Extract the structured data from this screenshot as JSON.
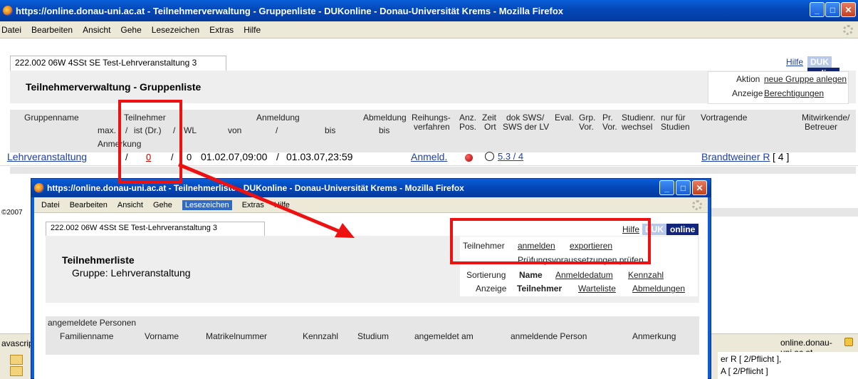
{
  "outer": {
    "title": "https://online.donau-uni.ac.at - Teilnehmerverwaltung - Gruppenliste - DUKonline - Donau-Universität Krems - Mozilla Firefox",
    "menu": [
      "Datei",
      "Bearbeiten",
      "Ansicht",
      "Gehe",
      "Lesezeichen",
      "Extras",
      "Hilfe"
    ],
    "course_tab": "222.002 06W 4SSt SE Test-Lehrveranstaltung 3",
    "help": "Hilfe",
    "duk": "DUK",
    "online": "online",
    "page_title": "Teilnehmerverwaltung - Gruppenliste",
    "aktion_label": "Aktion",
    "aktion_link": "neue Gruppe anlegen",
    "anzeige_label": "Anzeige",
    "anzeige_link": "Berechtigungen",
    "headers": {
      "gruppenname": "Gruppenname",
      "teilnehmer": "Teilnehmer",
      "anmeldung": "Anmeldung",
      "abmeldung": "Abmeldung",
      "reihungs": "Reihungs-",
      "anz": "Anz.",
      "zeit": "Zeit",
      "dok_sws": "dok SWS/",
      "eval": "Eval.",
      "grp": "Grp.",
      "pr": "Pr.",
      "studienr": "Studienr.",
      "nur_fuer": "nur für",
      "vortragende": "Vortragende",
      "mitwirkende": "Mitwirkende/",
      "max": "max.",
      "slash1": "/",
      "ist": "ist (Dr.)",
      "slash2": "/",
      "wl": "WL",
      "von": "von",
      "slash3": "/",
      "bis1": "bis",
      "bis2": "bis",
      "verfahren": "verfahren",
      "pos": "Pos.",
      "ort": "Ort",
      "sws_lv": "SWS der LV",
      "vor1": "Vor.",
      "vor2": "Vor.",
      "wechsel": "wechsel",
      "studien": "Studien",
      "betreuer": "Betreuer",
      "anmerkung": "Anmerkung"
    },
    "row": {
      "gruppenname": "Lehrveranstaltung",
      "slash_a": "/",
      "ist_value": "0",
      "slash_b": "/",
      "wl_value": "0",
      "von": "01.02.07,09:00",
      "slash_c": "/",
      "bis": "01.03.07,23:59",
      "anmeld": "Anmeld.",
      "sws": "5.3 / 4",
      "vortragende": "Brandtweiner R",
      "vortragende_count": "[ 4 ]"
    },
    "copyright": "©2007",
    "status_left": "avascrip",
    "status_right": "online.donau-uni.ac.at",
    "bg_line1": "er R [ 2/Pflicht ],",
    "bg_line2": "A [ 2/Pflicht ]"
  },
  "popup": {
    "title": "https://online.donau-uni.ac.at - Teilnehmerliste - DUKonline - Donau-Universität Krems - Mozilla Firefox",
    "menu": [
      "Datei",
      "Bearbeiten",
      "Ansicht",
      "Gehe",
      "Lesezeichen",
      "Extras",
      "Hilfe"
    ],
    "course_tab": "222.002 06W 4SSt SE Test-Lehrveranstaltung 3",
    "help": "Hilfe",
    "duk": "DUK",
    "online": "online",
    "page_title": "Teilnehmerliste",
    "gruppe": "Gruppe: Lehrveranstaltung",
    "teilnehmer_label": "Teilnehmer",
    "anmelden": "anmelden",
    "exportieren": "exportieren",
    "pruefung": "Prüfungsvoraussetzungen prüfen",
    "sortierung_label": "Sortierung",
    "sort_name": "Name",
    "sort_anmeldedatum": "Anmeldedatum",
    "sort_kennzahl": "Kennzahl",
    "anzeige_label": "Anzeige",
    "anz_teilnehmer": "Teilnehmer",
    "anz_warteliste": "Warteliste",
    "anz_abmeldungen": "Abmeldungen",
    "section": "angemeldete Personen",
    "cols": [
      "Familienname",
      "Vorname",
      "Matrikelnummer",
      "Kennzahl",
      "Studium",
      "angemeldet am",
      "anmeldende Person",
      "Anmerkung"
    ]
  },
  "colors": {
    "title_bar": "#0a5fd8",
    "annotation": "#ee1111",
    "link": "#1f3fa3"
  }
}
